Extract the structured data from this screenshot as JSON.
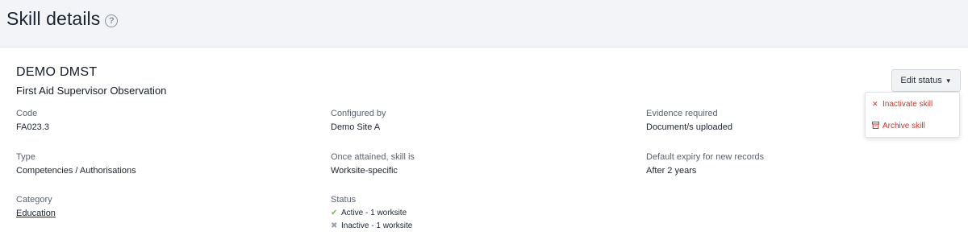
{
  "header": {
    "title": "Skill details",
    "help_icon": "?"
  },
  "skill": {
    "code_title": "DEMO DMST",
    "name": "First Aid Supervisor Observation"
  },
  "fields": {
    "code": {
      "label": "Code",
      "value": "FA023.3"
    },
    "configured_by": {
      "label": "Configured by",
      "value": "Demo Site A"
    },
    "evidence_required": {
      "label": "Evidence required",
      "value": "Document/s uploaded"
    },
    "type": {
      "label": "Type",
      "value": "Competencies / Authorisations"
    },
    "once_attained": {
      "label": "Once attained, skill is",
      "value": "Worksite-specific"
    },
    "default_expiry": {
      "label": "Default expiry for new records",
      "value": "After 2 years"
    },
    "category": {
      "label": "Category",
      "value": "Education"
    },
    "status": {
      "label": "Status",
      "active": "Active - 1 worksite",
      "inactive": "Inactive - 1 worksite"
    }
  },
  "edit_status": {
    "label": "Edit status",
    "menu": [
      {
        "label": "Inactivate skill",
        "icon": "x-icon"
      },
      {
        "label": "Archive skill",
        "icon": "archive-icon"
      }
    ]
  },
  "colors": {
    "danger": "#c0392b",
    "check": "#6bbf3b",
    "page_bg": "#f3f4f8"
  }
}
